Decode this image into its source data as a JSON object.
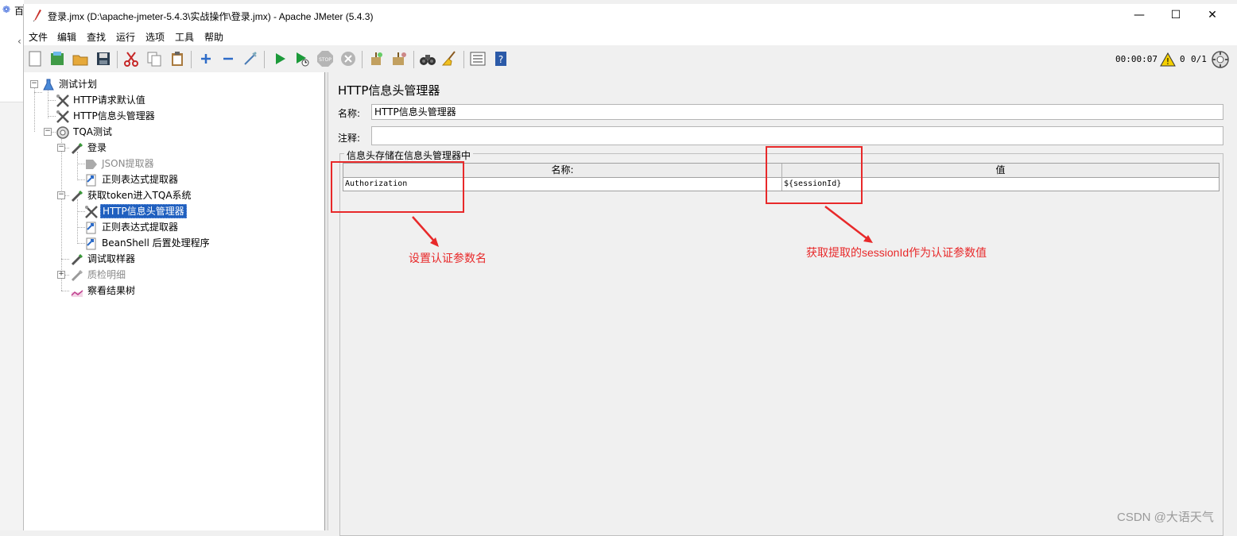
{
  "background": {
    "browser_tab_text": "百"
  },
  "window": {
    "title": "登录.jmx (D:\\apache-jmeter-5.4.3\\实战操作\\登录.jmx) - Apache JMeter (5.4.3)",
    "controls": {
      "minimize": "—",
      "maximize": "☐",
      "close": "✕"
    }
  },
  "menu": [
    "文件",
    "编辑",
    "查找",
    "运行",
    "选项",
    "工具",
    "帮助"
  ],
  "toolbar": {
    "timer": "00:00:07",
    "warnings": "0",
    "threads": "0/1"
  },
  "tree": {
    "nodes": [
      {
        "label": "测试计划"
      },
      {
        "label": "HTTP请求默认值"
      },
      {
        "label": "HTTP信息头管理器"
      },
      {
        "label": "TQA测试"
      },
      {
        "label": "登录"
      },
      {
        "label": "JSON提取器"
      },
      {
        "label": "正则表达式提取器"
      },
      {
        "label": "获取token进入TQA系统"
      },
      {
        "label": "HTTP信息头管理器"
      },
      {
        "label": "正则表达式提取器"
      },
      {
        "label": "BeanShell 后置处理程序"
      },
      {
        "label": "调试取样器"
      },
      {
        "label": "质检明细"
      },
      {
        "label": "察看结果树"
      }
    ]
  },
  "editor": {
    "panel_title": "HTTP信息头管理器",
    "name_label": "名称:",
    "name_value": "HTTP信息头管理器",
    "comment_label": "注释:",
    "comment_value": "",
    "group_title": "信息头存储在信息头管理器中",
    "table": {
      "columns": [
        "名称:",
        "值"
      ],
      "rows": [
        {
          "name": "Authorization",
          "value": "${sessionId}"
        }
      ]
    }
  },
  "annotations": {
    "left": "设置认证参数名",
    "right": "获取提取的sessionId作为认证参数值",
    "color": "#e8292a"
  },
  "watermark": "CSDN @大语天气"
}
